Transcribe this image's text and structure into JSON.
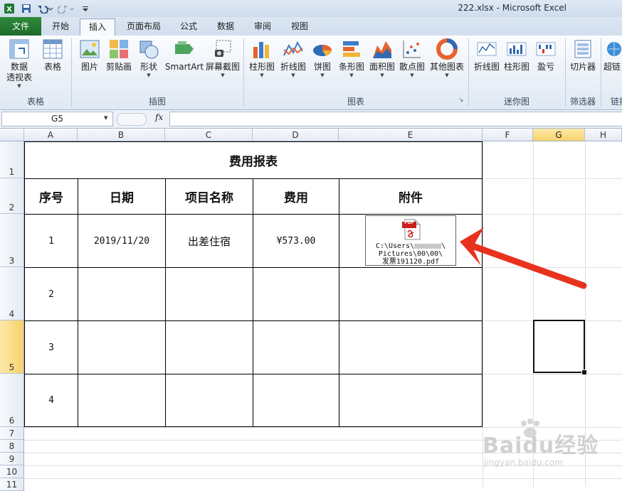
{
  "window": {
    "title": "222.xlsx - Microsoft Excel"
  },
  "tabs": [
    {
      "label": "文件"
    },
    {
      "label": "开始"
    },
    {
      "label": "插入"
    },
    {
      "label": "页面布局"
    },
    {
      "label": "公式"
    },
    {
      "label": "数据"
    },
    {
      "label": "审阅"
    },
    {
      "label": "视图"
    }
  ],
  "ribbon": {
    "groups": {
      "tables": "表格",
      "illustrations": "插图",
      "charts": "图表",
      "sparklines": "迷你图",
      "filter": "筛选器",
      "links": "链接"
    },
    "items": {
      "pivot": "数据\n透视表",
      "table": "表格",
      "picture": "图片",
      "clipart": "剪贴画",
      "shapes": "形状",
      "smartart": "SmartArt",
      "screenshot": "屏幕截图",
      "col_chart": "柱形图",
      "line_chart": "折线图",
      "pie_chart": "饼图",
      "bar_chart": "条形图",
      "area_chart": "面积图",
      "scatter_chart": "散点图",
      "other_chart": "其他图表",
      "spark_line": "折线图",
      "spark_col": "柱形图",
      "spark_winloss": "盈亏",
      "slicer": "切片器",
      "hyperlink": "超链"
    }
  },
  "formula_bar": {
    "name_box": "G5",
    "fx": "fx",
    "content": ""
  },
  "columns": [
    "A",
    "B",
    "C",
    "D",
    "E",
    "F",
    "G",
    "H"
  ],
  "rows": [
    "1",
    "2",
    "3",
    "4",
    "5",
    "6",
    "7",
    "8",
    "9",
    "10",
    "11"
  ],
  "selected": {
    "column": "G",
    "row": "5"
  },
  "sheet": {
    "title": "费用报表",
    "headers": [
      "序号",
      "日期",
      "项目名称",
      "费用",
      "附件"
    ],
    "records": [
      {
        "no": "1",
        "date": "2019/11/20",
        "item": "出差住宿",
        "cost": "¥573.00"
      },
      {
        "no": "2",
        "date": "",
        "item": "",
        "cost": ""
      },
      {
        "no": "3",
        "date": "",
        "item": "",
        "cost": ""
      },
      {
        "no": "4",
        "date": "",
        "item": "",
        "cost": ""
      }
    ],
    "attachment": {
      "badge": "PDF",
      "line1": "C:\\Users\\",
      "line2": "Pictures\\00\\00\\",
      "line3": "发票191120.pdf"
    }
  },
  "watermark": {
    "logo": "Baidu经验",
    "url": "jingyan.baidu.com"
  },
  "colors": {
    "excel_green": "#1d6b2a",
    "selected_header": "#f7d26b",
    "arrow_red": "#e8321e"
  }
}
